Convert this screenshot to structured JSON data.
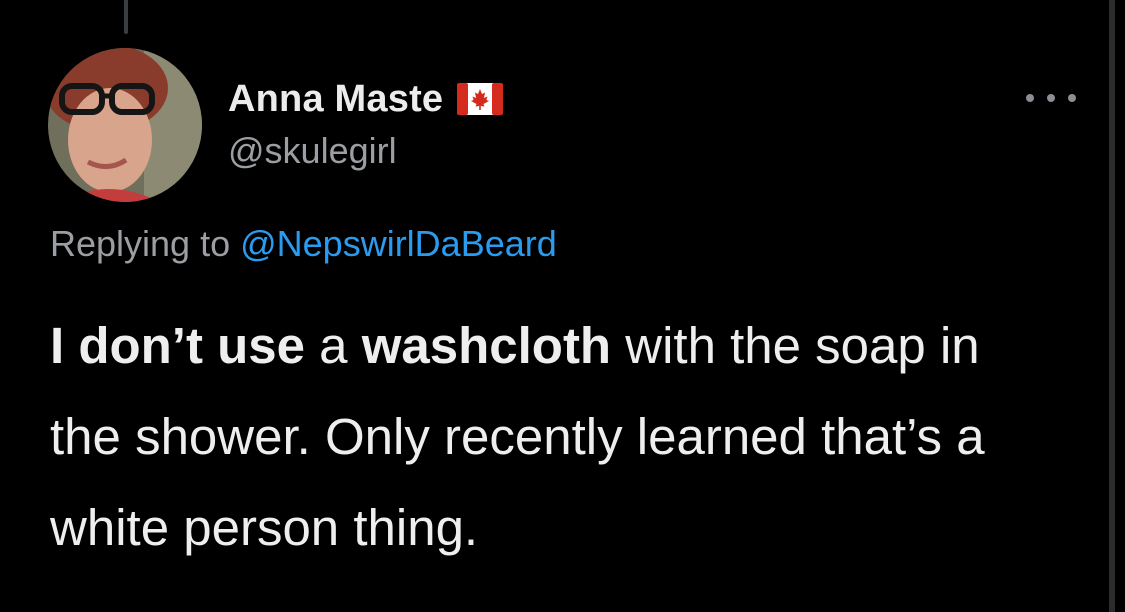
{
  "user": {
    "display_name": "Anna Maste",
    "handle": "@skulegirl",
    "flag_icon": "canada-flag-icon"
  },
  "menu": {
    "icon": "more-options-icon"
  },
  "reply": {
    "prefix": "Replying to ",
    "mention": "@NepswirlDaBeard"
  },
  "tweet": {
    "segments": [
      "I don’t use",
      " a ",
      "washcloth",
      " with the soap in the shower. Only recently learned that’s a white person thing."
    ]
  },
  "colors": {
    "background": "#000000",
    "mention": "#2b9bf0",
    "secondary_text": "#9b9fa3",
    "primary_text": "#eeeeee",
    "flag_red": "#d52b1e"
  }
}
